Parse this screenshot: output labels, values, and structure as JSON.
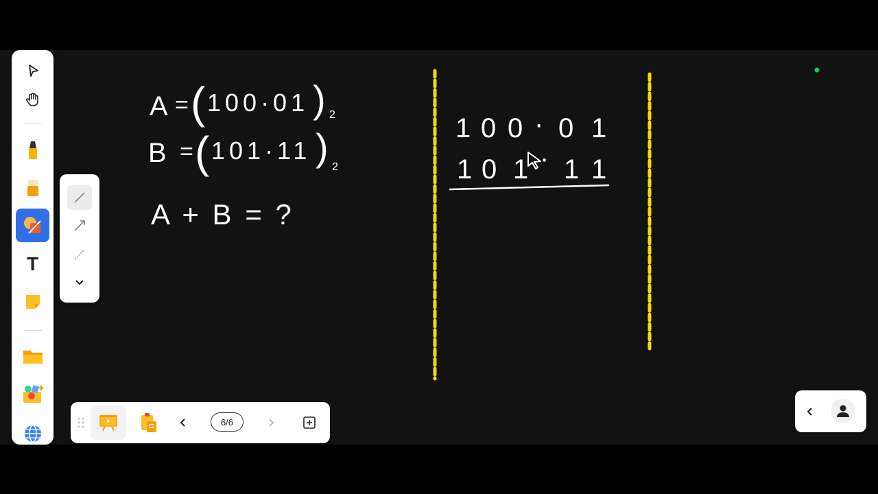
{
  "whiteboard": {
    "equation_a": {
      "lhs": "A",
      "eq": "=",
      "open": "(",
      "value": "100·01",
      "close": ")",
      "base": "2"
    },
    "equation_b": {
      "lhs": "B",
      "eq": "=",
      "open": "(",
      "value": "101·11",
      "close": ")",
      "base": "2"
    },
    "question": "A + B = ?",
    "addition": {
      "row1": [
        "1",
        "0",
        "0",
        "·",
        "0",
        "1"
      ],
      "row2": [
        "1",
        "0",
        "1",
        "·",
        "1",
        "1"
      ]
    },
    "colors": {
      "ink": "#ffffff",
      "divider": "#f5d90a",
      "dot": "#22c55e",
      "active_tool": "#2f6fe8"
    }
  },
  "tool_rail": {
    "items": [
      {
        "name": "select-tool",
        "icon": "cursor-icon"
      },
      {
        "name": "hand-tool",
        "icon": "hand-icon"
      },
      {
        "name": "pen-tool",
        "icon": "marker-icon"
      },
      {
        "name": "eraser-tool",
        "icon": "eraser-icon"
      },
      {
        "name": "shape-tool",
        "icon": "shapes-icon",
        "active": true
      },
      {
        "name": "text-tool",
        "icon": "text-icon",
        "glyph": "T"
      },
      {
        "name": "sticky-note-tool",
        "icon": "sticky-note-icon"
      },
      {
        "name": "folder-tool",
        "icon": "folder-icon"
      },
      {
        "name": "media-tool",
        "icon": "media-icon"
      },
      {
        "name": "browser-tool",
        "icon": "globe-icon"
      }
    ]
  },
  "line_panel": {
    "options": [
      "solid-line",
      "arrow-line",
      "dashed-line"
    ],
    "selected": "solid-line",
    "more_icon": "chevron-down-icon"
  },
  "bottom_bar": {
    "page_counter": "6/6",
    "icons": [
      "drag-handle-icon",
      "presentation-icon",
      "clipboard-icon",
      "chevron-left-icon",
      "chevron-right-icon",
      "add-page-icon"
    ]
  },
  "user_panel": {
    "icons": [
      "chevron-left-icon",
      "user-icon"
    ]
  }
}
